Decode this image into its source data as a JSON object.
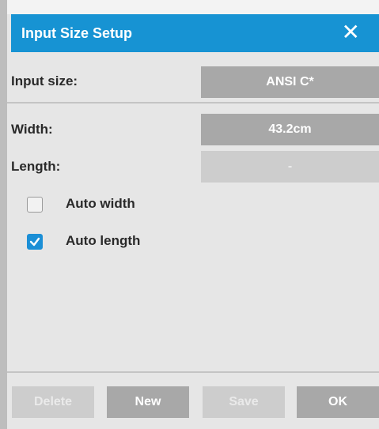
{
  "dialog": {
    "title": "Input Size Setup",
    "close_symbol": "✕"
  },
  "fields": {
    "input_size": {
      "label": "Input size:",
      "value": "ANSI C*"
    },
    "width": {
      "label": "Width:",
      "value": "43.2cm"
    },
    "length": {
      "label": "Length:",
      "value": "-"
    }
  },
  "options": {
    "auto_width": {
      "label": "Auto width",
      "checked": false
    },
    "auto_length": {
      "label": "Auto length",
      "checked": true
    }
  },
  "buttons": {
    "delete": "Delete",
    "new": "New",
    "save": "Save",
    "ok": "OK"
  },
  "colors": {
    "titlebar": "#1793d3",
    "checkbox_checked": "#1b8fd6",
    "enabled_control": "#a8a8a8",
    "disabled_control": "#cdcdcd"
  },
  "icons": {
    "close": "close-icon",
    "check": "checkmark-icon"
  }
}
